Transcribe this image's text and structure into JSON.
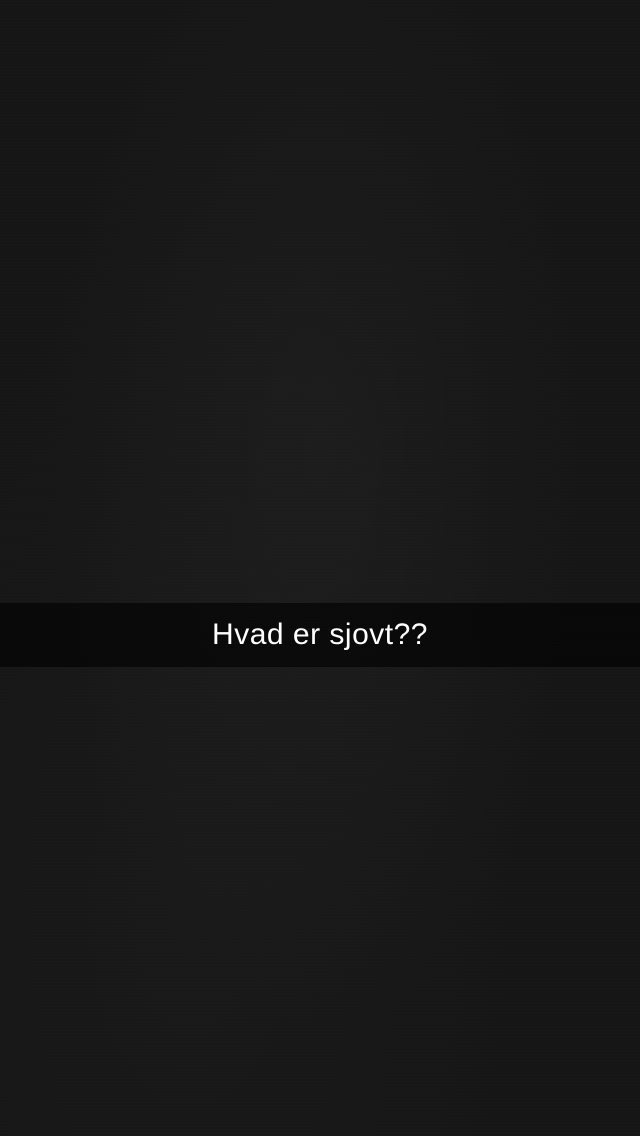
{
  "snap": {
    "caption": "Hvad er sjovt??",
    "background_color": "#161616",
    "caption_bar_color": "#000000"
  }
}
